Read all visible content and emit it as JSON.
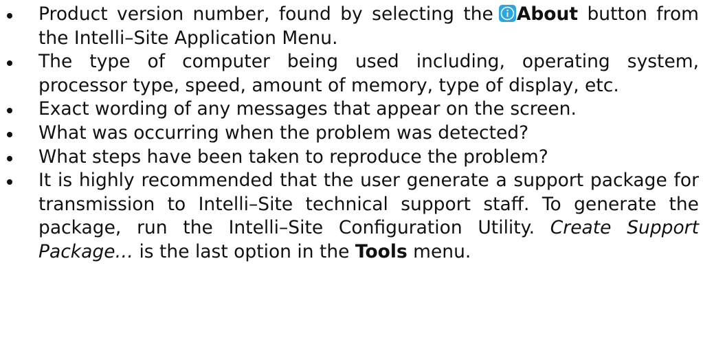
{
  "bullets": {
    "item1": {
      "text_before": "Product version number, found by selecting the",
      "icon": "info-icon",
      "bold": "About",
      "text_after": "button from the Intelli–Site Application Menu."
    },
    "item2": {
      "text": "The type of computer being used including, operating system, processor type, speed, amount of memory, type of display, etc."
    },
    "item3": {
      "text": "Exact wording of any messages that appear on the screen."
    },
    "item4": {
      "text": "What was occurring when the problem was detected?"
    },
    "item5": {
      "text": "What steps have been taken to reproduce the problem?"
    },
    "item6": {
      "text_before": "It is highly recommended that the user generate a support package for transmission to Intelli–Site technical support staff. To generate the package, run the Intelli–Site Configuration Utility.",
      "italic": "Create Support Package…",
      "text_middle": "is the last option in the",
      "bold": "Tools",
      "text_after": "menu."
    }
  },
  "colors": {
    "text": "#111111",
    "icon_fill": "#2aa6e0",
    "icon_glyph": "#ffffff"
  }
}
